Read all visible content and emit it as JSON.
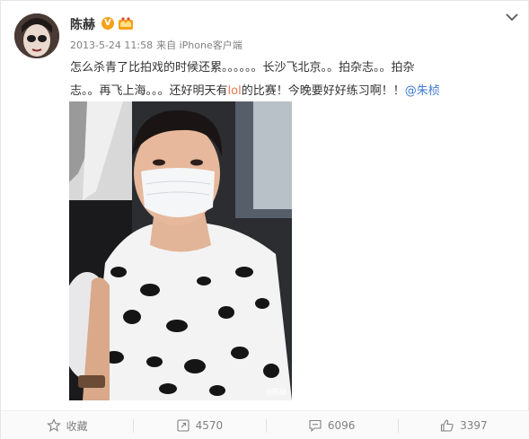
{
  "user": {
    "name": "陈赫",
    "verified_mark": "V"
  },
  "meta": {
    "timestamp": "2013-5-24 11:58",
    "source": "来自 iPhone客户端"
  },
  "post": {
    "line1": "怎么杀青了比拍戏的时候还累。。。。。。长沙飞北京。。拍杂志。。拍杂",
    "line2_a": "志。。再飞上海。。。还好明天有",
    "line2_hl": "lol",
    "line2_b": "的比赛！今晚要好好练习啊！！",
    "mention": "@朱桢"
  },
  "photo": {
    "watermark": "@陈赫"
  },
  "footer": {
    "favorite_label": "收藏",
    "repost_count": "4570",
    "comment_count": "6096",
    "like_count": "3397"
  },
  "colors": {
    "accent": "#eb7350",
    "link": "#3c7bd2",
    "badge": "#f6a21a"
  }
}
